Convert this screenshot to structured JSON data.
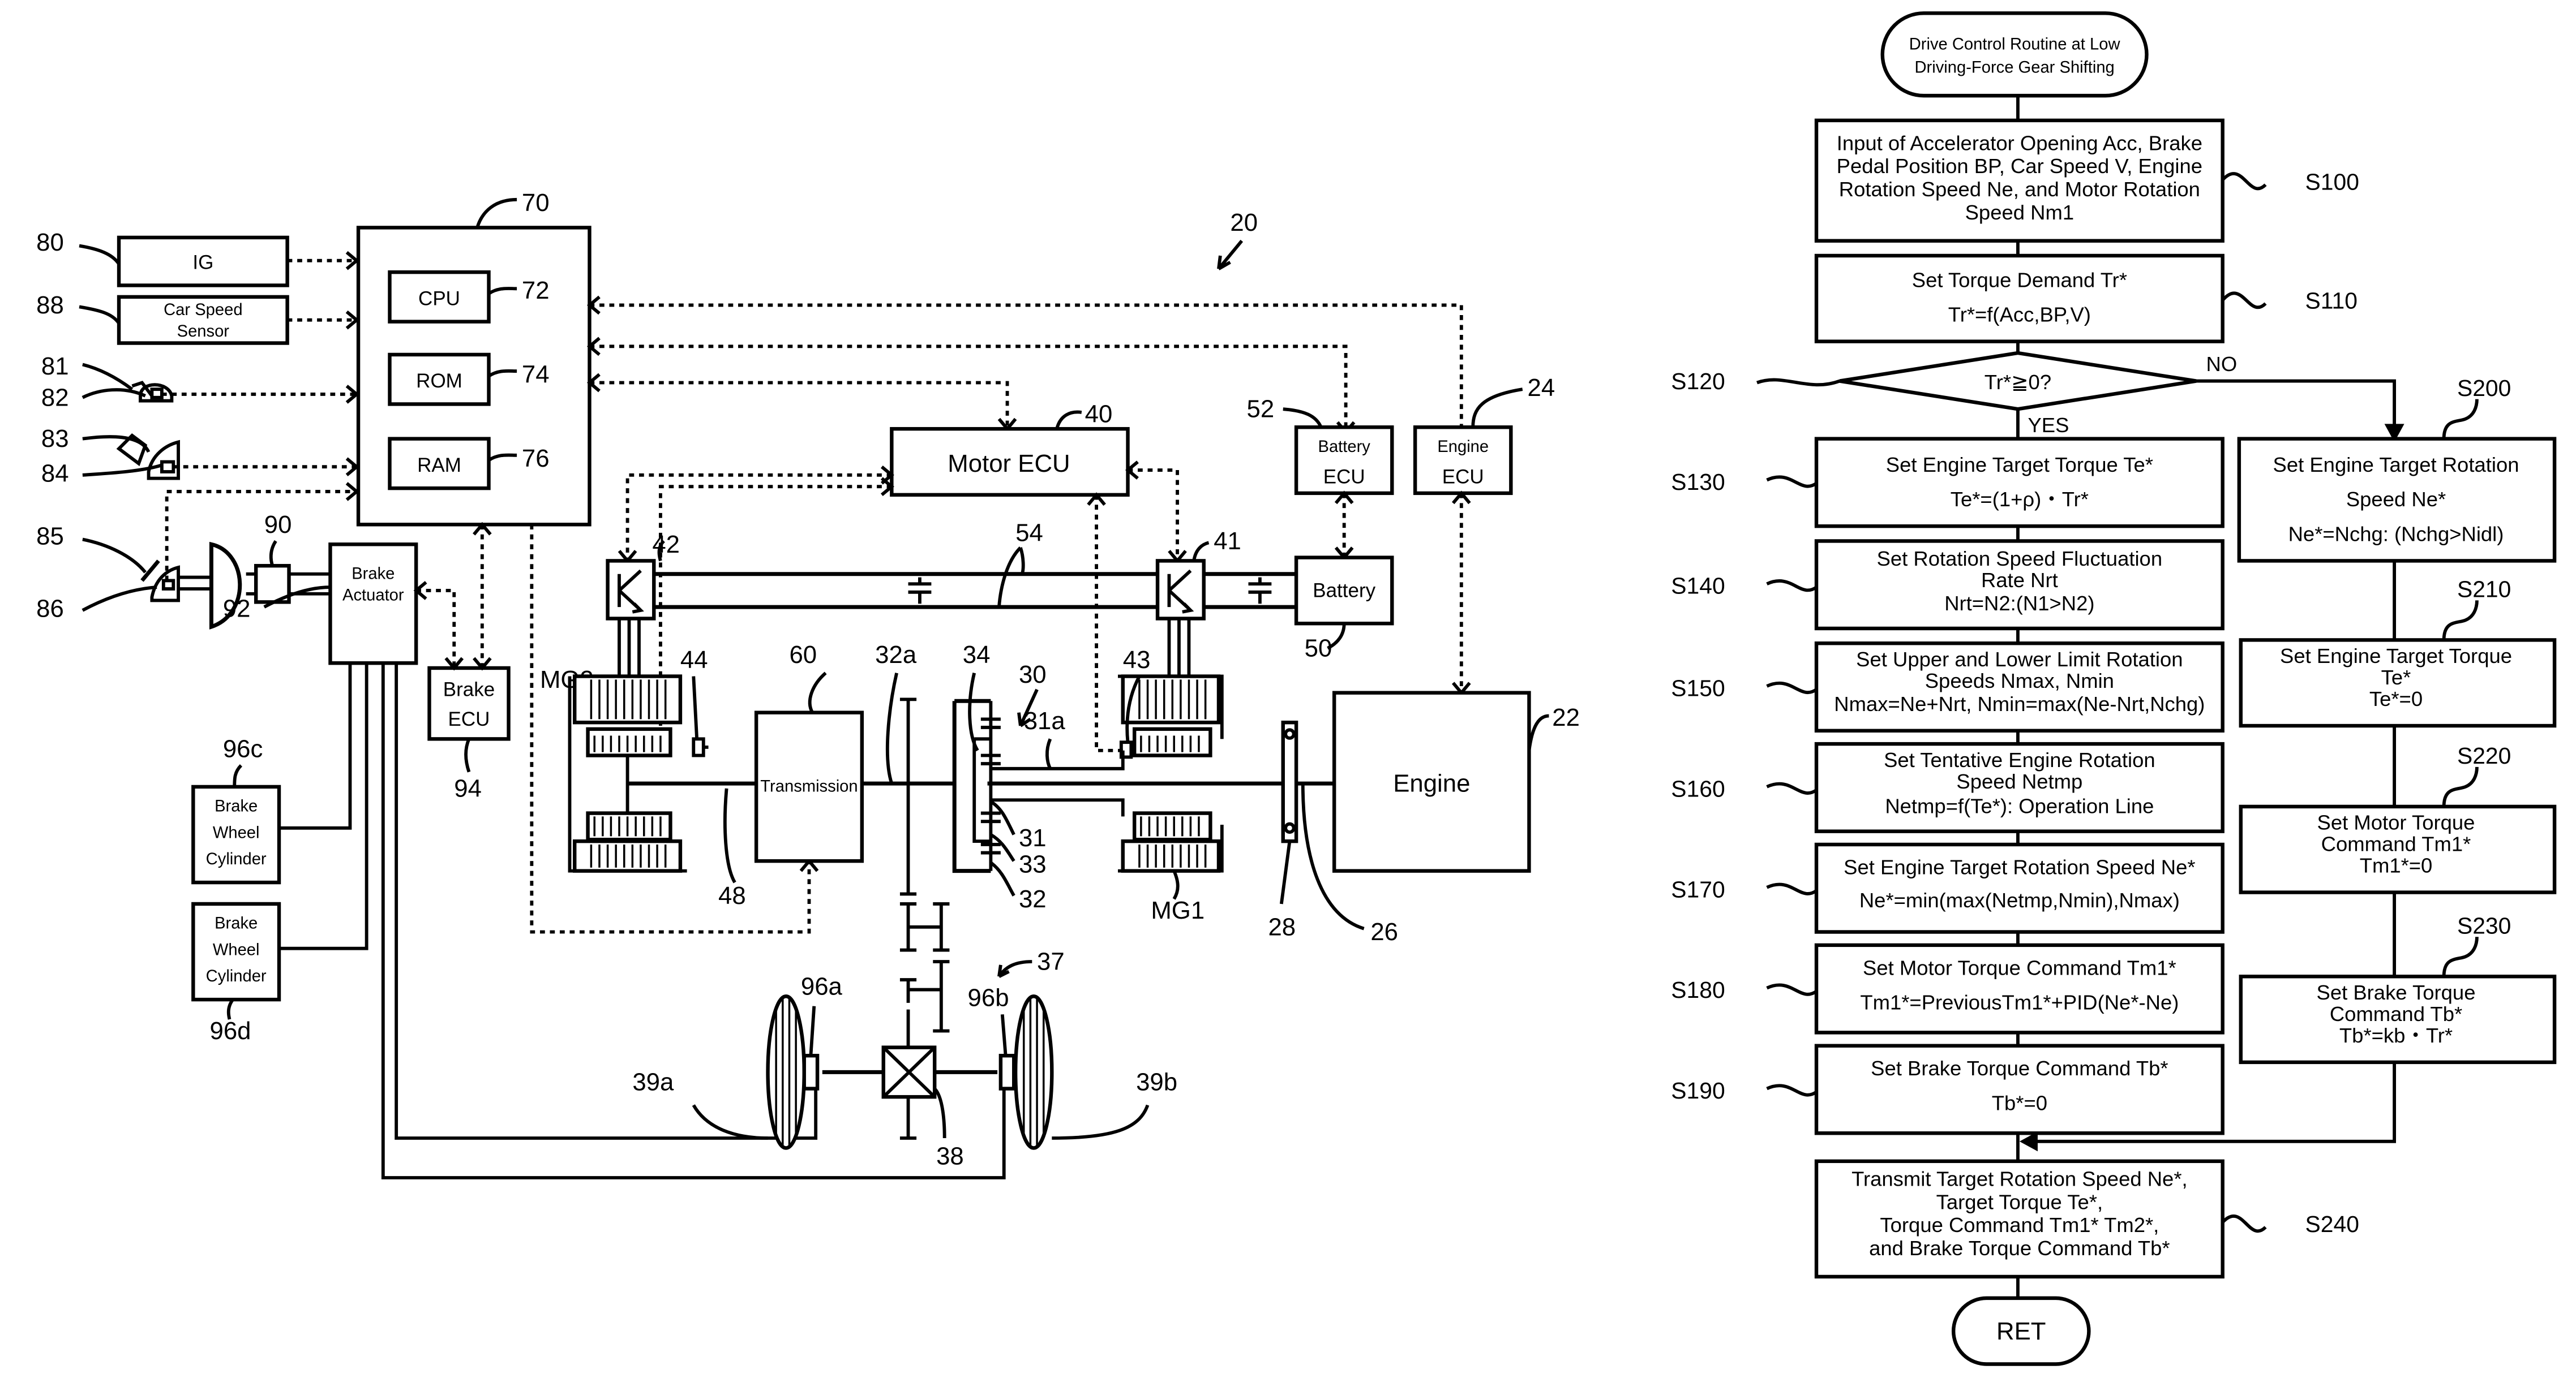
{
  "figure": {
    "system_ref": "20",
    "left_diagram": {
      "ecu_main": {
        "ref": "70",
        "cpu": {
          "label": "CPU",
          "ref": "72"
        },
        "rom": {
          "label": "ROM",
          "ref": "74"
        },
        "ram": {
          "label": "RAM",
          "ref": "76"
        }
      },
      "inputs": [
        {
          "ref": "80",
          "label": "IG"
        },
        {
          "ref": "88",
          "label": "Car Speed Sensor",
          "line1": "Car Speed",
          "line2": "Sensor"
        },
        {
          "ref": "81"
        },
        {
          "ref": "82"
        },
        {
          "ref": "83"
        },
        {
          "ref": "84"
        },
        {
          "ref": "85"
        },
        {
          "ref": "86"
        }
      ],
      "master_cylinder_ref": "90",
      "brake_actuator": {
        "ref": "92",
        "line1": "Brake",
        "line2": "Actuator"
      },
      "brake_ecu": {
        "ref": "94",
        "line1": "Brake",
        "line2": "ECU"
      },
      "wheel_cylinder_c": {
        "ref": "96c",
        "line1": "Brake",
        "line2": "Wheel",
        "line3": "Cylinder"
      },
      "wheel_cylinder_d": {
        "ref": "96d",
        "line1": "Brake",
        "line2": "Wheel",
        "line3": "Cylinder"
      },
      "motor_ecu": {
        "ref": "40",
        "label": "Motor ECU"
      },
      "battery_ecu": {
        "ref": "52",
        "line1": "Battery",
        "line2": "ECU"
      },
      "engine_ecu": {
        "ref": "24",
        "line1": "Engine",
        "line2": "ECU"
      },
      "inverter_mg2_ref": "42",
      "inverter_mg1_ref": "41",
      "power_line_ref": "54",
      "battery": {
        "ref": "50",
        "label": "Battery"
      },
      "mg2": {
        "label": "MG2",
        "sensor_ref": "44"
      },
      "mg1": {
        "label": "MG1",
        "sensor_ref": "43"
      },
      "transmission": {
        "ref": "60",
        "label": "Transmission"
      },
      "engine": {
        "ref": "22",
        "label": "Engine"
      },
      "refs": {
        "ring_gear_shaft": "32a",
        "carrier": "34",
        "planetary": "30",
        "sun_shaft": "31a",
        "sun": "31",
        "pinion": "33",
        "ring": "32",
        "shaft48": "48",
        "damper": "28",
        "crankshaft": "26",
        "gear_mech": "37",
        "differential": "38",
        "wheel_a": "39a",
        "wheel_b": "39b",
        "wheel_cyl_a": "96a",
        "wheel_cyl_b": "96b"
      }
    },
    "flowchart": {
      "start": {
        "line1": "Drive Control Routine at Low",
        "line2": "Driving-Force Gear Shifting"
      },
      "steps": [
        {
          "id": "S100",
          "lines": [
            "Input of Accelerator Opening Acc, Brake",
            "Pedal Position BP, Car Speed V, Engine",
            "Rotation Speed Ne, and Motor Rotation",
            "Speed Nm1"
          ]
        },
        {
          "id": "S110",
          "lines": [
            "Set Torque Demand Tr*",
            "Tr*=f(Acc,BP,V)"
          ]
        },
        {
          "id": "S120",
          "lines": [
            "Tr*≧0?"
          ],
          "yes": "YES",
          "no": "NO"
        },
        {
          "id": "S130",
          "lines": [
            "Set Engine Target Torque Te*",
            "Te*=(1+ρ)・Tr*"
          ]
        },
        {
          "id": "S140",
          "lines": [
            "Set Rotation Speed Fluctuation",
            "Rate Nrt",
            "Nrt=N2:(N1>N2)"
          ]
        },
        {
          "id": "S150",
          "lines": [
            "Set Upper and Lower Limit Rotation",
            "Speeds Nmax, Nmin",
            "Nmax=Ne+Nrt,  Nmin=max(Ne-Nrt,Nchg)"
          ]
        },
        {
          "id": "S160",
          "lines": [
            "Set Tentative Engine Rotation",
            "Speed Netmp",
            "Netmp=f(Te*): Operation Line"
          ]
        },
        {
          "id": "S170",
          "lines": [
            "Set Engine Target Rotation Speed Ne*",
            "Ne*=min(max(Netmp,Nmin),Nmax)"
          ]
        },
        {
          "id": "S180",
          "lines": [
            "Set Motor Torque Command Tm1*",
            "Tm1*=PreviousTm1*+PID(Ne*-Ne)"
          ]
        },
        {
          "id": "S190",
          "lines": [
            "Set Brake Torque Command Tb*",
            "Tb*=0"
          ]
        },
        {
          "id": "S200",
          "lines": [
            "Set Engine Target Rotation",
            "Speed Ne*",
            "Ne*=Nchg: (Nchg>Nidl)"
          ]
        },
        {
          "id": "S210",
          "lines": [
            "Set Engine Target Torque",
            "Te*",
            "Te*=0"
          ]
        },
        {
          "id": "S220",
          "lines": [
            "Set Motor Torque",
            "Command Tm1*",
            "Tm1*=0"
          ]
        },
        {
          "id": "S230",
          "lines": [
            "Set Brake Torque",
            "Command Tb*",
            "Tb*=kb・Tr*"
          ]
        },
        {
          "id": "S240",
          "lines": [
            "Transmit Target Rotation Speed Ne*,",
            "Target Torque Te*,",
            "Torque Command Tm1* Tm2*,",
            "and Brake Torque Command Tb*"
          ]
        }
      ],
      "end": {
        "label": "RET"
      }
    }
  }
}
